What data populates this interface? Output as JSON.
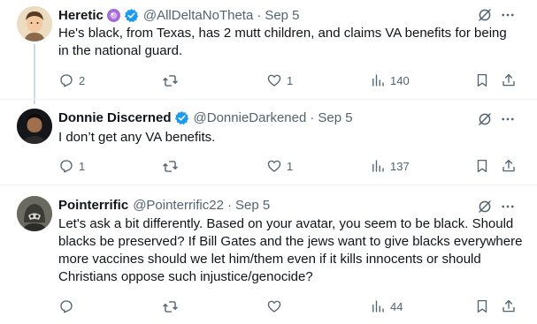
{
  "tweets": [
    {
      "name": "Heretic",
      "handle": "@AllDeltaNoTheta",
      "separator": "·",
      "date": "Sep 5",
      "text": "He's black, from Texas, has 2 mutt children, and claims VA benefits for being in the national guard.",
      "replies": "2",
      "retweets": "",
      "likes": "1",
      "views": "140"
    },
    {
      "name": "Donnie Discerned",
      "handle": "@DonnieDarkened",
      "separator": "·",
      "date": "Sep 5",
      "text": "I don’t get any VA benefits.",
      "replies": "1",
      "retweets": "",
      "likes": "1",
      "views": "137"
    },
    {
      "name": "Pointerrific",
      "handle": "@Pointerrific22",
      "separator": "·",
      "date": "Sep 5",
      "text": "Let's ask a bit differently. Based on your avatar, you seem to be black. Should blacks be preserved?  If Bill Gates and the jews want to give blacks everywhere more vaccines should we let him/them even if it kills innocents or should Christians oppose such injustice/genocide?",
      "replies": "",
      "retweets": "",
      "likes": "",
      "views": "44"
    }
  ],
  "colors": {
    "verified_blue": "#1d9bf0",
    "secondary_text": "#536471",
    "primary_text": "#0f1419",
    "thread_line": "#cfd9de",
    "divider": "#eff3f4"
  },
  "icons": [
    "reply-icon",
    "retweet-icon",
    "like-icon",
    "views-icon",
    "bookmark-icon",
    "share-icon",
    "grok-icon",
    "more-icon",
    "verified-badge-icon",
    "purple-affiliate-badge-icon"
  ]
}
